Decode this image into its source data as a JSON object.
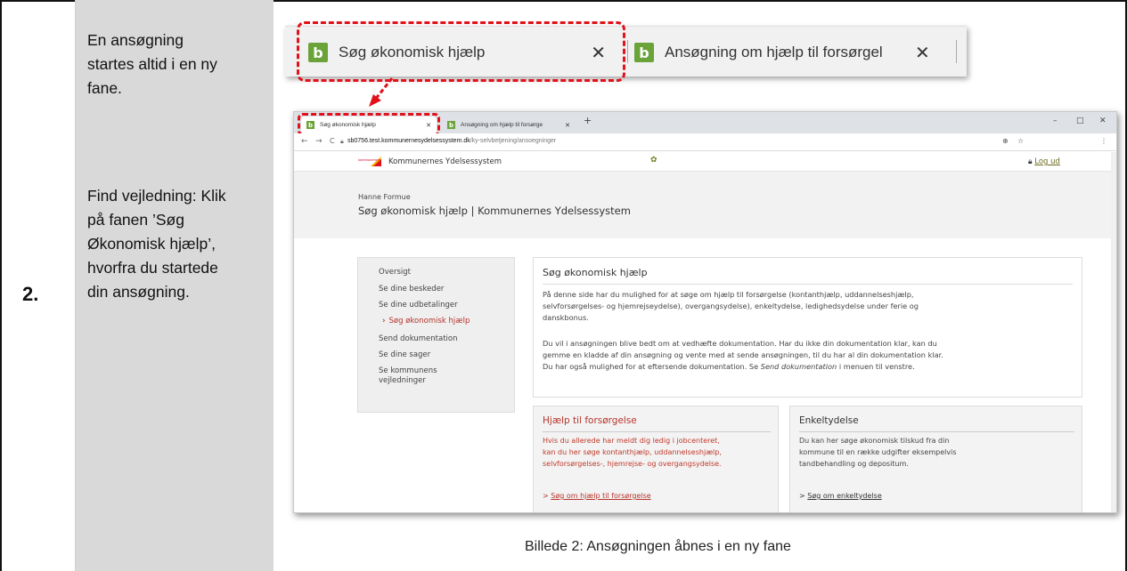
{
  "step_number": "2.",
  "instructions": {
    "para1": "En ansøgning\nstartes altid i en ny\nfane.",
    "para2": "Find vejledning: Klik\npå fanen ’Søg\nØkonomisk hjælp’,\nhvorfra du startede\ndin ansøgning."
  },
  "zoom_tabs": [
    {
      "favicon": "b",
      "title": "Søg økonomisk hjælp",
      "close": "✕"
    },
    {
      "favicon": "b",
      "title": "Ansøgning om hjælp til forsørgel",
      "close": "✕"
    }
  ],
  "browser": {
    "tabs": [
      {
        "favicon": "b",
        "title": "Søg økonomisk hjælp",
        "close": "✕"
      },
      {
        "favicon": "b",
        "title": "Ansøgning om hjælp til forsørge",
        "close": "✕"
      }
    ],
    "new_tab": "+",
    "window_controls": {
      "minimize": "–",
      "maximize": "□",
      "close": "✕"
    },
    "nav": {
      "back": "←",
      "forward": "→",
      "reload": "C"
    },
    "url_host": "sb0756.test.kommunernesydelsessystem.dk",
    "url_path": "/ky-selvbetjening/ansoegninger",
    "zoom_icon": "⊕",
    "star_icon": "☆",
    "menu_icon": "⋮"
  },
  "site": {
    "logo_text": "kommunernes",
    "name": "Kommunernes Ydelsessystem",
    "logout_label": "Log ud",
    "user_name": "Hanne Formue",
    "page_title": "Søg økonomisk hjælp | Kommunernes Ydelsessystem"
  },
  "sidenav": [
    "Oversigt",
    "Se dine beskeder",
    "Se dine udbetalinger",
    "Søg økonomisk hjælp",
    "Send dokumentation",
    "Se dine sager",
    "Se kommunens",
    "vejledninger"
  ],
  "sidenav_active_chevron": "›",
  "intro": {
    "title": "Søg økonomisk hjælp",
    "p1_l1": "På denne side har du mulighed for at søge om hjælp til forsørgelse  (kontanthjælp, uddannelseshjælp,",
    "p1_l2": "selvforsørgelses- og hjemrejseydelse), overgangsydelse), enkeltydelse, ledighedsydelse under ferie og",
    "p1_l3": "danskbonus.",
    "p2_l1": "Du vil i ansøgningen blive bedt om at vedhæfte dokumentation. Har du ikke din dokumentation klar, kan du",
    "p2_l2": "gemme en kladde af din ansøgning og vente med at sende ansøgningen, til du har al din dokumentation klar.",
    "p2_l3a": "Du har også mulighed for at eftersende dokumentation. Se ",
    "p2_l3_em": "Send dokumentation",
    "p2_l3b": " i menuen til venstre."
  },
  "cards": [
    {
      "title": "Hjælp til forsørgelse",
      "lines": [
        "Hvis du allerede har meldt dig ledig i jobcenteret,",
        "kan du her søge kontanthjælp, uddannelseshjælp,",
        "selvforsørgelses-, hjemrejse- og overgangsydelse."
      ],
      "link": "Søg om hjælp til forsørgelse"
    },
    {
      "title": "Enkeltydelse",
      "lines": [
        "Du kan her søge økonomisk tilskud fra din",
        "kommune til en række udgifter eksempelvis",
        "tandbehandling og depositum."
      ],
      "link": "Søg om enkeltydelse"
    }
  ],
  "link_prefix": ">",
  "caption": "Billede 2: Ansøgningen åbnes i en ny fane",
  "colors": {
    "accent_red": "#e1111a",
    "favicon_green": "#6aa339",
    "active_nav": "#b6332a"
  }
}
